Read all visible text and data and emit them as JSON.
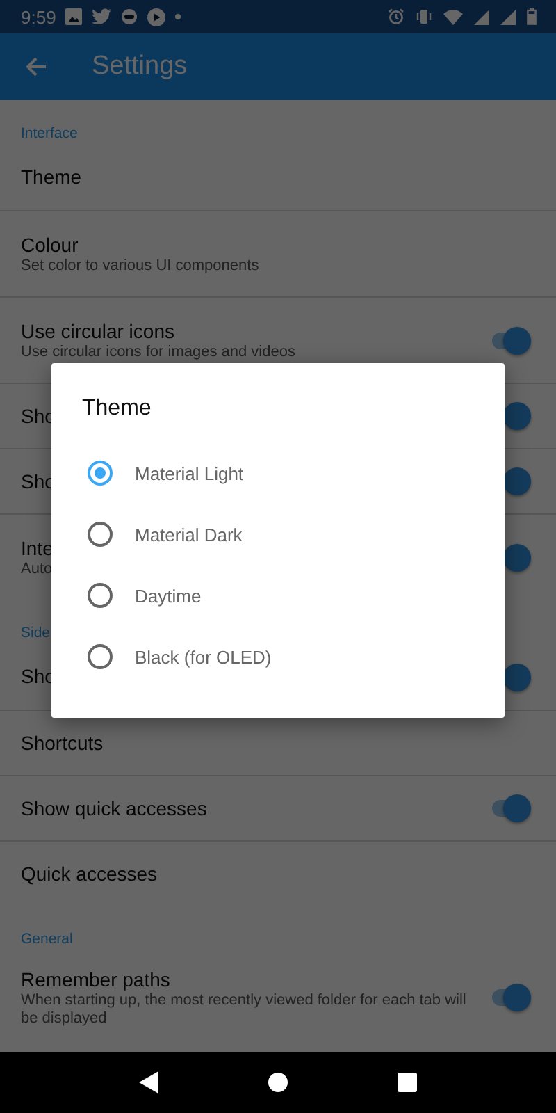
{
  "status_bar": {
    "time": "9:59"
  },
  "app_bar": {
    "title": "Settings"
  },
  "sections": [
    {
      "header": "Interface",
      "items": [
        {
          "kind": "plain",
          "title": "Theme"
        },
        {
          "kind": "plain",
          "title": "Colour",
          "subtitle": "Set color to various UI components"
        },
        {
          "kind": "toggle",
          "title": "Use circular icons",
          "subtitle": "Use circular icons for images and videos",
          "on": true
        },
        {
          "kind": "toggle",
          "title": "Sho",
          "on": true
        },
        {
          "kind": "toggle",
          "title": "Sho",
          "on": true
        },
        {
          "kind": "toggle",
          "title": "Inte",
          "subtitle": "Auto",
          "on": true
        }
      ]
    },
    {
      "header": "Side",
      "items": [
        {
          "kind": "toggle",
          "title": "Sho",
          "on": true
        },
        {
          "kind": "plain",
          "title": "Shortcuts"
        },
        {
          "kind": "toggle",
          "title": "Show quick accesses",
          "on": true
        },
        {
          "kind": "plain",
          "title": "Quick accesses"
        }
      ]
    },
    {
      "header": "General",
      "items": [
        {
          "kind": "toggle",
          "title": "Remember paths",
          "subtitle": "When starting up, the most recently viewed folder for each tab will be displayed",
          "on": true
        }
      ]
    }
  ],
  "dialog": {
    "title": "Theme",
    "options": [
      {
        "label": "Material Light",
        "selected": true
      },
      {
        "label": "Material Dark",
        "selected": false
      },
      {
        "label": "Daytime",
        "selected": false
      },
      {
        "label": "Black (for OLED)",
        "selected": false
      }
    ]
  }
}
